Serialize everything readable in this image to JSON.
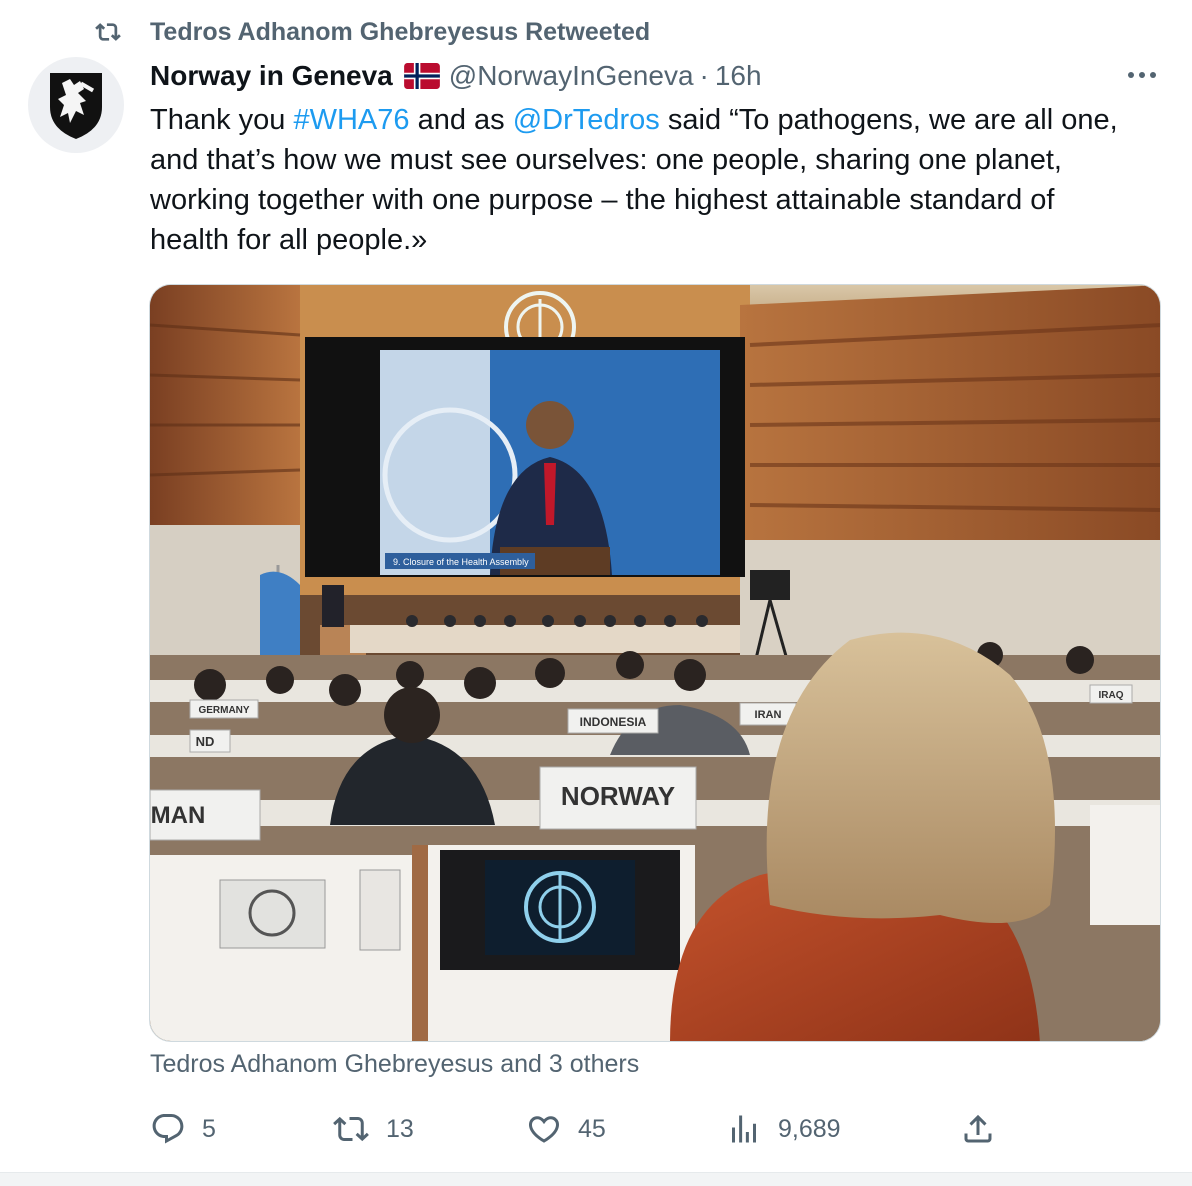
{
  "retweet": {
    "icon": "retweet-icon",
    "text": "Tedros Adhanom Ghebreyesus Retweeted"
  },
  "author": {
    "name": "Norway in Geneva",
    "flag_icon": "norway-flag-icon",
    "handle": "@NorwayInGeneva",
    "separator": "·",
    "time": "16h"
  },
  "tweet": {
    "text_1": "Thank you ",
    "hashtag": "#WHA76",
    "text_2": " and as ",
    "mention": "@DrTedros",
    "text_3": " said “To pathogens, we are all one, and that’s how we must see ourselves: one people, sharing one planet, working together with one purpose – the highest attainable standard of health for all people.»"
  },
  "media": {
    "screen_caption": "9. Closure of the Health Assembly",
    "placards": {
      "norway": "NORWAY",
      "indonesia": "INDONESIA",
      "germany": "GERMANY",
      "iran": "IRAN",
      "man": "MAN",
      "nd": "ND",
      "iraq": "IRAQ"
    }
  },
  "tagged": "Tedros Adhanom Ghebreyesus and 3 others",
  "actions": {
    "reply": {
      "icon": "reply-icon",
      "count": "5"
    },
    "retweet": {
      "icon": "retweet-icon",
      "count": "13"
    },
    "like": {
      "icon": "heart-icon",
      "count": "45"
    },
    "views": {
      "icon": "views-chart-icon",
      "count": "9,689"
    },
    "share": {
      "icon": "share-icon"
    }
  },
  "colors": {
    "link": "#1d9bf0",
    "secondary_text": "#536471",
    "primary_text": "#0f1419"
  }
}
